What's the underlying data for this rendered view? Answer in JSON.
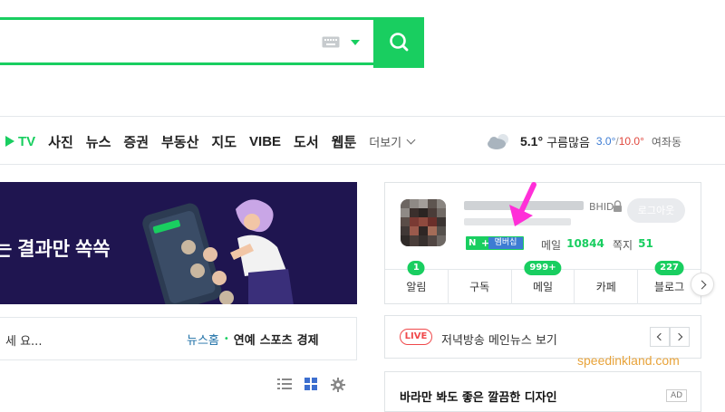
{
  "search": {
    "keyboard_icon": "keyboard-icon",
    "dropdown_icon": "caret-down-icon",
    "button_icon": "search-icon",
    "accent": "#19ce60"
  },
  "nav": {
    "tv": "TV",
    "items": [
      "사진",
      "뉴스",
      "증권",
      "부동산",
      "지도",
      "VIBE",
      "도서",
      "웹툰"
    ],
    "more": "더보기"
  },
  "weather": {
    "icon": "cloud-icon",
    "temp": "5.1°",
    "desc": "구름많음",
    "low": "3.0°",
    "slash": "/",
    "high": "10.0°",
    "location": "여좌동"
  },
  "banner": {
    "text": "는 결과만 쏙쏙",
    "background": "#1f1550"
  },
  "news": {
    "snippet": "세 요...",
    "tabs": [
      "뉴스홈",
      "연예",
      "스포츠",
      "경제"
    ]
  },
  "profile": {
    "id_suffix": "BHID",
    "logout": "로그아웃",
    "badge_n": "N",
    "badge_plus": "+",
    "membership": "멤버십",
    "mail_label": "메일",
    "mail_count": "10844",
    "note_label": "쪽지",
    "note_count": "51",
    "tabs": [
      {
        "label": "알림",
        "badge": "1"
      },
      {
        "label": "구독",
        "badge": ""
      },
      {
        "label": "메일",
        "badge": "999+"
      },
      {
        "label": "카페",
        "badge": ""
      },
      {
        "label": "블로그",
        "badge": "227"
      }
    ]
  },
  "live": {
    "badge": "LIVE",
    "text": "저녁방송 메인뉴스 보기"
  },
  "watermark": "speedinkland.com",
  "ad": {
    "text": "바라만 봐도 좋은 깔끔한 디자인",
    "tag": "AD"
  }
}
